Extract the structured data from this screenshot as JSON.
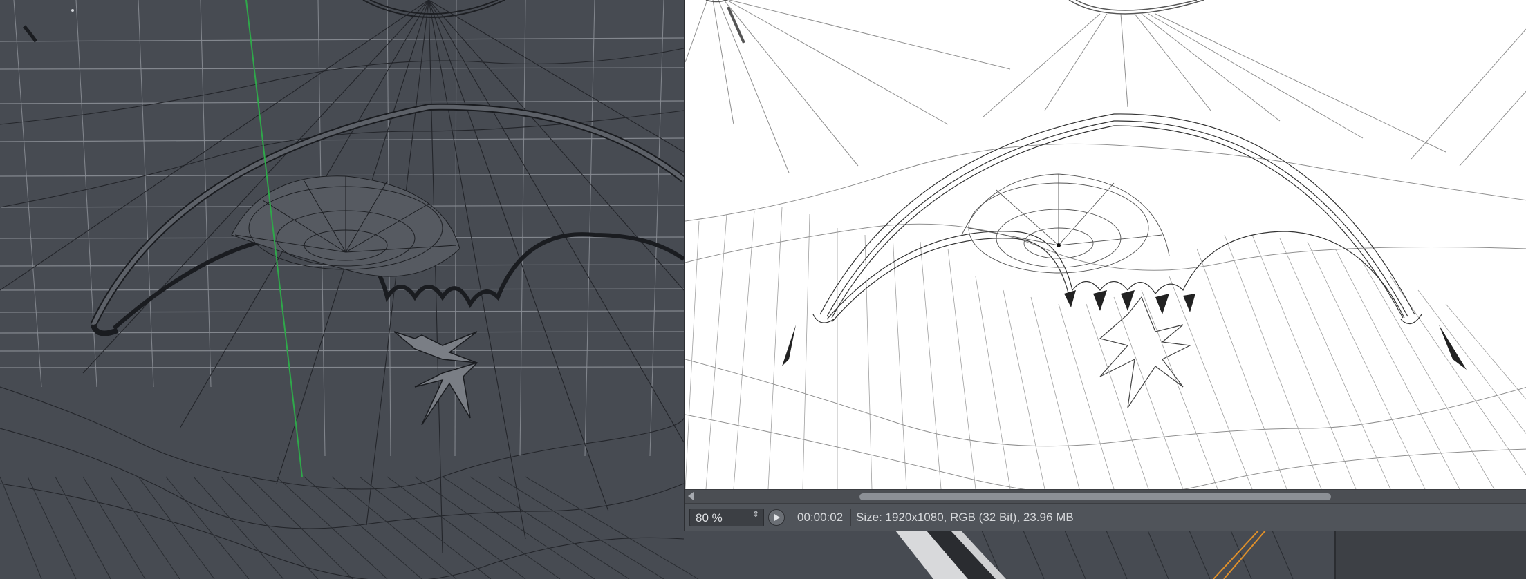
{
  "picture_viewer": {
    "zoom": {
      "value": "80 %",
      "stepper": "⇕"
    },
    "timecode": "00:00:02",
    "image_info": "Size: 1920x1080, RGB (32 Bit), 23.96 MB"
  },
  "colors": {
    "viewport_bg": "#474b52",
    "wire": "#23252a",
    "grid": "#8a8e95",
    "axis_y": "#2fa84a",
    "spline_orange": "#e0902a",
    "render_bg": "#ffffff"
  },
  "icons": {
    "play": "play-icon",
    "scroll_left": "arrow-left-icon"
  }
}
